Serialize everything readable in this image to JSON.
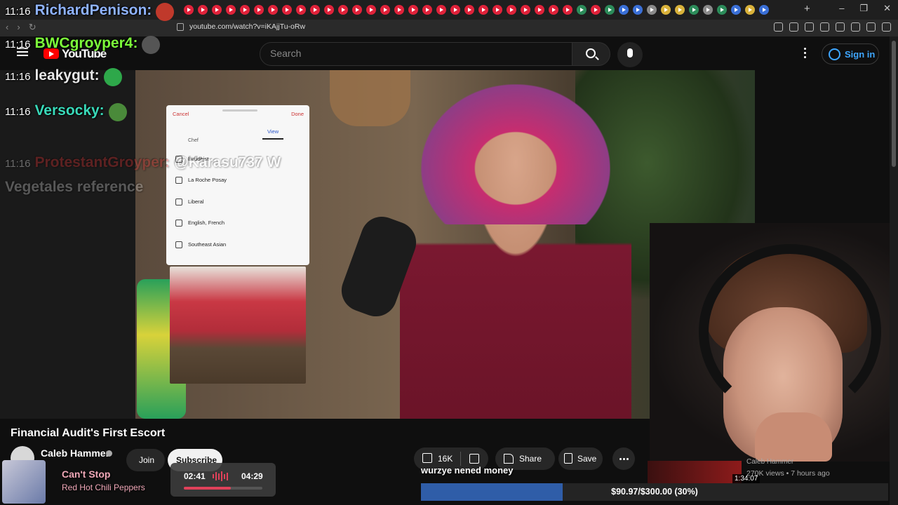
{
  "browser": {
    "url": "youtube.com/watch?v=iKAjjTu-oRw",
    "new_tab": "+",
    "window_controls": [
      "–",
      "❐",
      "✕"
    ],
    "back": "‹",
    "forward": "›",
    "reload": "↻"
  },
  "youtube": {
    "logo_text": "YouTube",
    "search_placeholder": "Search",
    "signin_label": "Sign in"
  },
  "chat": [
    {
      "time": "11:16",
      "name": "RichardPenison:",
      "color": "#8fb3ff",
      "emote_color": "#c0392b"
    },
    {
      "time": "11:16",
      "name": "BWCgroyper4:",
      "color": "#7cfc3a",
      "emote_color": "#555555"
    },
    {
      "time": "11:16",
      "name": "leakygut:",
      "color": "#e8e8e8",
      "emote_color": "#2ea84a"
    },
    {
      "time": "11:16",
      "name": "Versocky:",
      "color": "#39d9b9",
      "emote_color": "#4a8a3a"
    },
    {
      "time": "11:16",
      "name": "ProtestantGroyper:",
      "message": "@Karasu737 W",
      "color": "#d93030",
      "faded": true
    },
    {
      "time": "",
      "name": "Vegetales reference",
      "color": "#cccccc",
      "faded": true
    }
  ],
  "phone": {
    "cancel": "Cancel",
    "done": "Done",
    "partial_tab": "Edit",
    "view_tab": "View",
    "partial_row": "Chef",
    "rows": [
      "Buddhist",
      "La Roche Posay",
      "Liberal",
      "English, French",
      "Southeast Asian"
    ]
  },
  "video": {
    "title": "Financial Audit's First Escort",
    "channel": "Caleb Hammer",
    "join_label": "Join",
    "subscribe_label": "Subscribe",
    "likes": "16K",
    "share_label": "Share",
    "save_label": "Save"
  },
  "recommendation": {
    "channel": "Caleb Hammer",
    "meta": "270K views • 7 hours ago",
    "duration": "1:34:07"
  },
  "music": {
    "title": "Can't Stop",
    "artist": "Red Hot Chili Peppers",
    "current": "02:41",
    "total": "04:29",
    "progress": 0.6
  },
  "caption": "wurzye nened money",
  "donation_goal": {
    "label": "$90.97/$300.00 (30%)",
    "progress": 0.303
  },
  "colors": {
    "accent_red": "#ff0000",
    "link_blue": "#3ea6ff",
    "goal_blue": "#2f5da8",
    "music_pink": "#f0a8b8"
  }
}
